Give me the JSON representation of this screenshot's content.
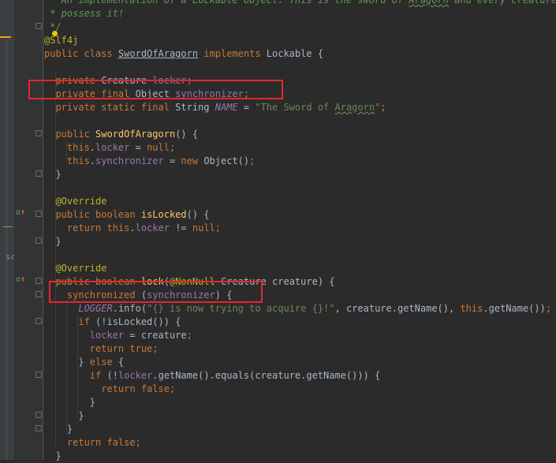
{
  "editor": {
    "side_label": "sc",
    "lines": [
      {
        "segments": [
          {
            "t": " * An implementation of a Lockable object. This is the sword of ",
            "c": "cmt"
          },
          {
            "t": "Aragorn",
            "c": "cmt typo"
          },
          {
            "t": " and every creature wants",
            "c": "cmt"
          }
        ]
      },
      {
        "segments": [
          {
            "t": " * possess it!",
            "c": "cmt"
          }
        ]
      },
      {
        "segments": [
          {
            "t": " */",
            "c": "cmt"
          }
        ]
      },
      {
        "segments": [
          {
            "t": "@Slf4j",
            "c": "ann"
          }
        ]
      },
      {
        "segments": [
          {
            "t": "public class ",
            "c": "kw"
          },
          {
            "t": "SwordOfAragorn",
            "c": "cls"
          },
          {
            "t": " implements ",
            "c": "kw"
          },
          {
            "t": "Lockable {",
            "c": ""
          }
        ]
      },
      {
        "segments": []
      },
      {
        "segments": [
          {
            "t": "  private ",
            "c": "kw"
          },
          {
            "t": "Creature ",
            "c": "strike"
          },
          {
            "t": "locker",
            "c": "fld strike"
          },
          {
            "t": ";",
            "c": "kw"
          }
        ]
      },
      {
        "segments": [
          {
            "t": "  private final ",
            "c": "kw"
          },
          {
            "t": "Object ",
            "c": ""
          },
          {
            "t": "synchronizer",
            "c": "fld"
          },
          {
            "t": ";",
            "c": "kw"
          }
        ]
      },
      {
        "segments": [
          {
            "t": "  private static final ",
            "c": "kw"
          },
          {
            "t": "String ",
            "c": ""
          },
          {
            "t": "NAME",
            "c": "sf"
          },
          {
            "t": " = ",
            "c": ""
          },
          {
            "t": "\"The Sword of ",
            "c": "str"
          },
          {
            "t": "Aragorn",
            "c": "str typo"
          },
          {
            "t": "\"",
            "c": "str"
          },
          {
            "t": ";",
            "c": "kw"
          }
        ]
      },
      {
        "segments": []
      },
      {
        "segments": [
          {
            "t": "  public ",
            "c": "kw"
          },
          {
            "t": "SwordOfAragorn",
            "c": "mth"
          },
          {
            "t": "() {",
            "c": ""
          }
        ]
      },
      {
        "segments": [
          {
            "t": "    this",
            "c": "kw"
          },
          {
            "t": ".",
            "c": ""
          },
          {
            "t": "locker",
            "c": "fld"
          },
          {
            "t": " = ",
            "c": ""
          },
          {
            "t": "null",
            "c": "kw"
          },
          {
            "t": ";",
            "c": "kw"
          }
        ]
      },
      {
        "segments": [
          {
            "t": "    this",
            "c": "kw"
          },
          {
            "t": ".",
            "c": ""
          },
          {
            "t": "synchronizer",
            "c": "fld"
          },
          {
            "t": " = ",
            "c": ""
          },
          {
            "t": "new ",
            "c": "kw"
          },
          {
            "t": "Object()",
            "c": ""
          },
          {
            "t": ";",
            "c": "kw"
          }
        ]
      },
      {
        "segments": [
          {
            "t": "  }",
            "c": ""
          }
        ]
      },
      {
        "segments": []
      },
      {
        "segments": [
          {
            "t": "  @Override",
            "c": "ann"
          }
        ]
      },
      {
        "segments": [
          {
            "t": "  public boolean ",
            "c": "kw"
          },
          {
            "t": "isLocked",
            "c": "mth"
          },
          {
            "t": "() {",
            "c": ""
          }
        ]
      },
      {
        "segments": [
          {
            "t": "    return this",
            "c": "kw"
          },
          {
            "t": ".",
            "c": ""
          },
          {
            "t": "locker",
            "c": "fld"
          },
          {
            "t": " != ",
            "c": ""
          },
          {
            "t": "null",
            "c": "kw"
          },
          {
            "t": ";",
            "c": "kw"
          }
        ]
      },
      {
        "segments": [
          {
            "t": "  }",
            "c": ""
          }
        ]
      },
      {
        "segments": []
      },
      {
        "segments": [
          {
            "t": "  @Override",
            "c": "ann"
          }
        ]
      },
      {
        "segments": [
          {
            "t": "  public boolean ",
            "c": "kw"
          },
          {
            "t": "lock",
            "c": "mth"
          },
          {
            "t": "(",
            "c": ""
          },
          {
            "t": "@NonNull ",
            "c": "ann"
          },
          {
            "t": "Creature ",
            "c": ""
          },
          {
            "t": "creature) {",
            "c": ""
          }
        ]
      },
      {
        "segments": [
          {
            "t": "    synchronized ",
            "c": "kw"
          },
          {
            "t": "(",
            "c": ""
          },
          {
            "t": "synchronizer",
            "c": "fld"
          },
          {
            "t": ") {",
            "c": ""
          }
        ]
      },
      {
        "segments": [
          {
            "t": "      ",
            "c": ""
          },
          {
            "t": "LOGGER",
            "c": "sf"
          },
          {
            "t": ".info(",
            "c": ""
          },
          {
            "t": "\"{} is now trying to acquire {}!\"",
            "c": "str"
          },
          {
            "t": ", creature.getName(), ",
            "c": ""
          },
          {
            "t": "this",
            "c": "kw"
          },
          {
            "t": ".getName())",
            "c": ""
          },
          {
            "t": ";",
            "c": "kw"
          }
        ]
      },
      {
        "segments": [
          {
            "t": "      if ",
            "c": "kw"
          },
          {
            "t": "(!isLocked()) {",
            "c": ""
          }
        ]
      },
      {
        "segments": [
          {
            "t": "        ",
            "c": ""
          },
          {
            "t": "locker",
            "c": "fld"
          },
          {
            "t": " = creature",
            "c": ""
          },
          {
            "t": ";",
            "c": "kw"
          }
        ]
      },
      {
        "segments": [
          {
            "t": "        return true",
            "c": "kw"
          },
          {
            "t": ";",
            "c": "kw"
          }
        ]
      },
      {
        "segments": [
          {
            "t": "      } ",
            "c": ""
          },
          {
            "t": "else ",
            "c": "kw"
          },
          {
            "t": "{",
            "c": ""
          }
        ]
      },
      {
        "segments": [
          {
            "t": "        if ",
            "c": "kw"
          },
          {
            "t": "(!",
            "c": ""
          },
          {
            "t": "locker",
            "c": "fld"
          },
          {
            "t": ".getName().equals(creature.getName())) {",
            "c": ""
          }
        ]
      },
      {
        "segments": [
          {
            "t": "          return false",
            "c": "kw"
          },
          {
            "t": ";",
            "c": "kw"
          }
        ]
      },
      {
        "segments": [
          {
            "t": "        }",
            "c": ""
          }
        ]
      },
      {
        "segments": [
          {
            "t": "      }",
            "c": ""
          }
        ]
      },
      {
        "segments": [
          {
            "t": "    }",
            "c": ""
          }
        ]
      },
      {
        "segments": [
          {
            "t": "    return false",
            "c": "kw"
          },
          {
            "t": ";",
            "c": "kw"
          }
        ]
      },
      {
        "segments": [
          {
            "t": "  }",
            "c": ""
          }
        ]
      }
    ]
  }
}
